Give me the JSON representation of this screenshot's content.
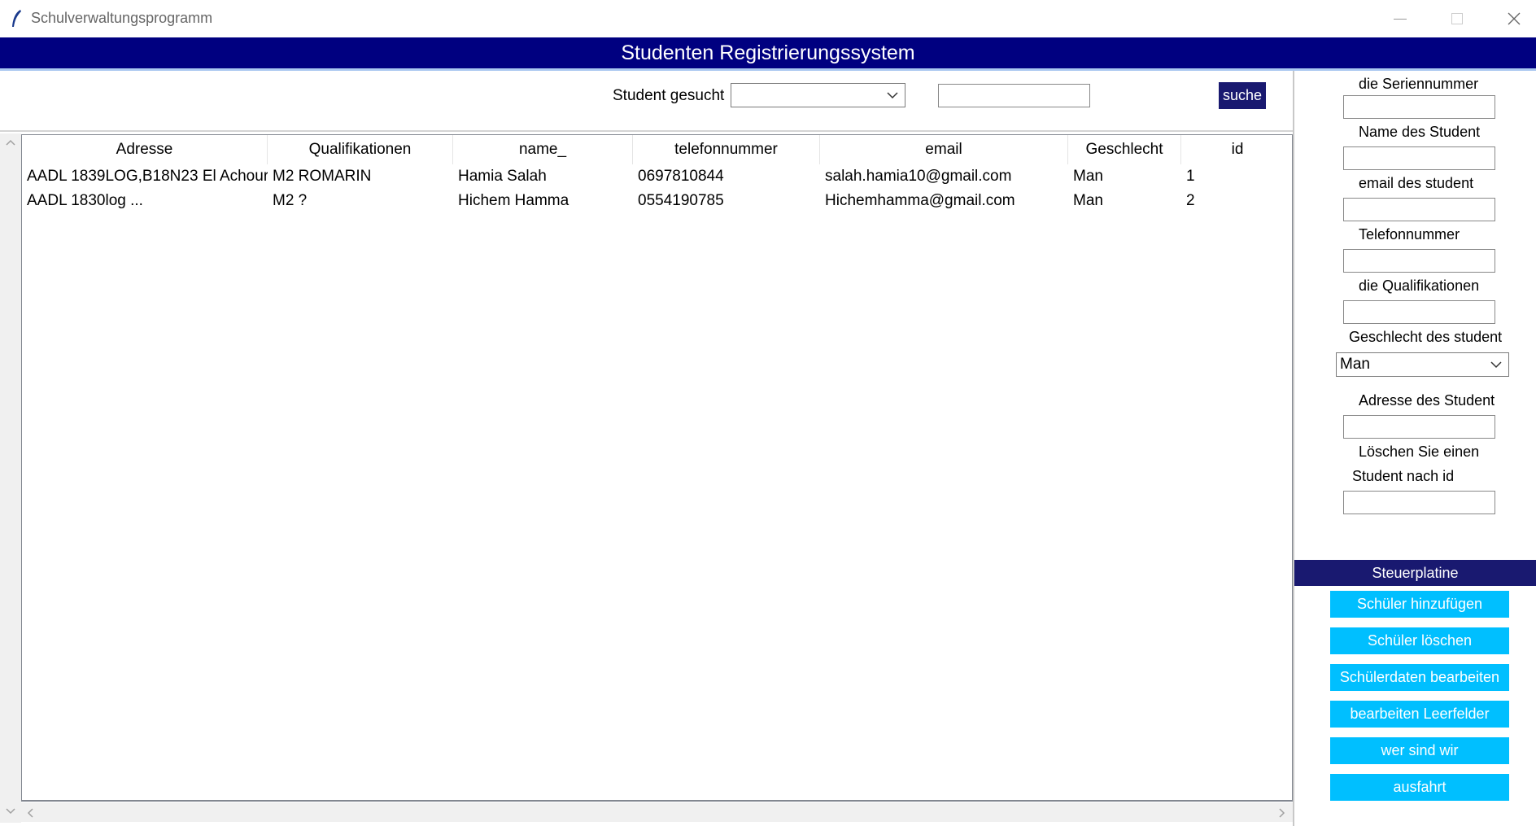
{
  "window": {
    "title": "Schulverwaltungsprogramm",
    "icon": "feather-icon"
  },
  "header": {
    "title": "Studenten Registrierungssystem"
  },
  "search": {
    "label": "Student gesucht",
    "combo_value": "",
    "input_value": "",
    "button_label": "suche"
  },
  "table": {
    "columns": [
      "Adresse",
      "Qualifikationen",
      "name_",
      "telefonnummer",
      "email",
      "Geschlecht",
      "id"
    ],
    "rows": [
      [
        "AADL 1839LOG,B18N23 El Achour",
        "M2 ROMARIN",
        "Hamia Salah",
        "0697810844",
        "salah.hamia10@gmail.com",
        "Man",
        "1"
      ],
      [
        "AADL 1830log ...",
        "M2 ?",
        "Hichem Hamma",
        "0554190785",
        "Hichemhamma@gmail.com",
        "Man",
        "2"
      ]
    ]
  },
  "form": {
    "serial_label": "die Seriennummer",
    "name_label": "Name des Student",
    "email_label": "email des student",
    "phone_label": "Telefonnummer",
    "qual_label": "die Qualifikationen",
    "gender_label": "Geschlecht des student",
    "gender_value": "Man",
    "address_label": "Adresse des Student",
    "delete_label_1": "Löschen Sie einen",
    "delete_label_2": "Student nach id"
  },
  "control_panel": {
    "title": "Steuerplatine",
    "buttons": [
      "Schüler hinzufügen",
      "Schüler löschen",
      "Schülerdaten bearbeiten",
      "bearbeiten Leerfelder",
      "wer sind wir",
      "ausfahrt"
    ]
  },
  "colors": {
    "header_bg": "#000080",
    "dark_button": "#191970",
    "action_button": "#00bfff"
  }
}
